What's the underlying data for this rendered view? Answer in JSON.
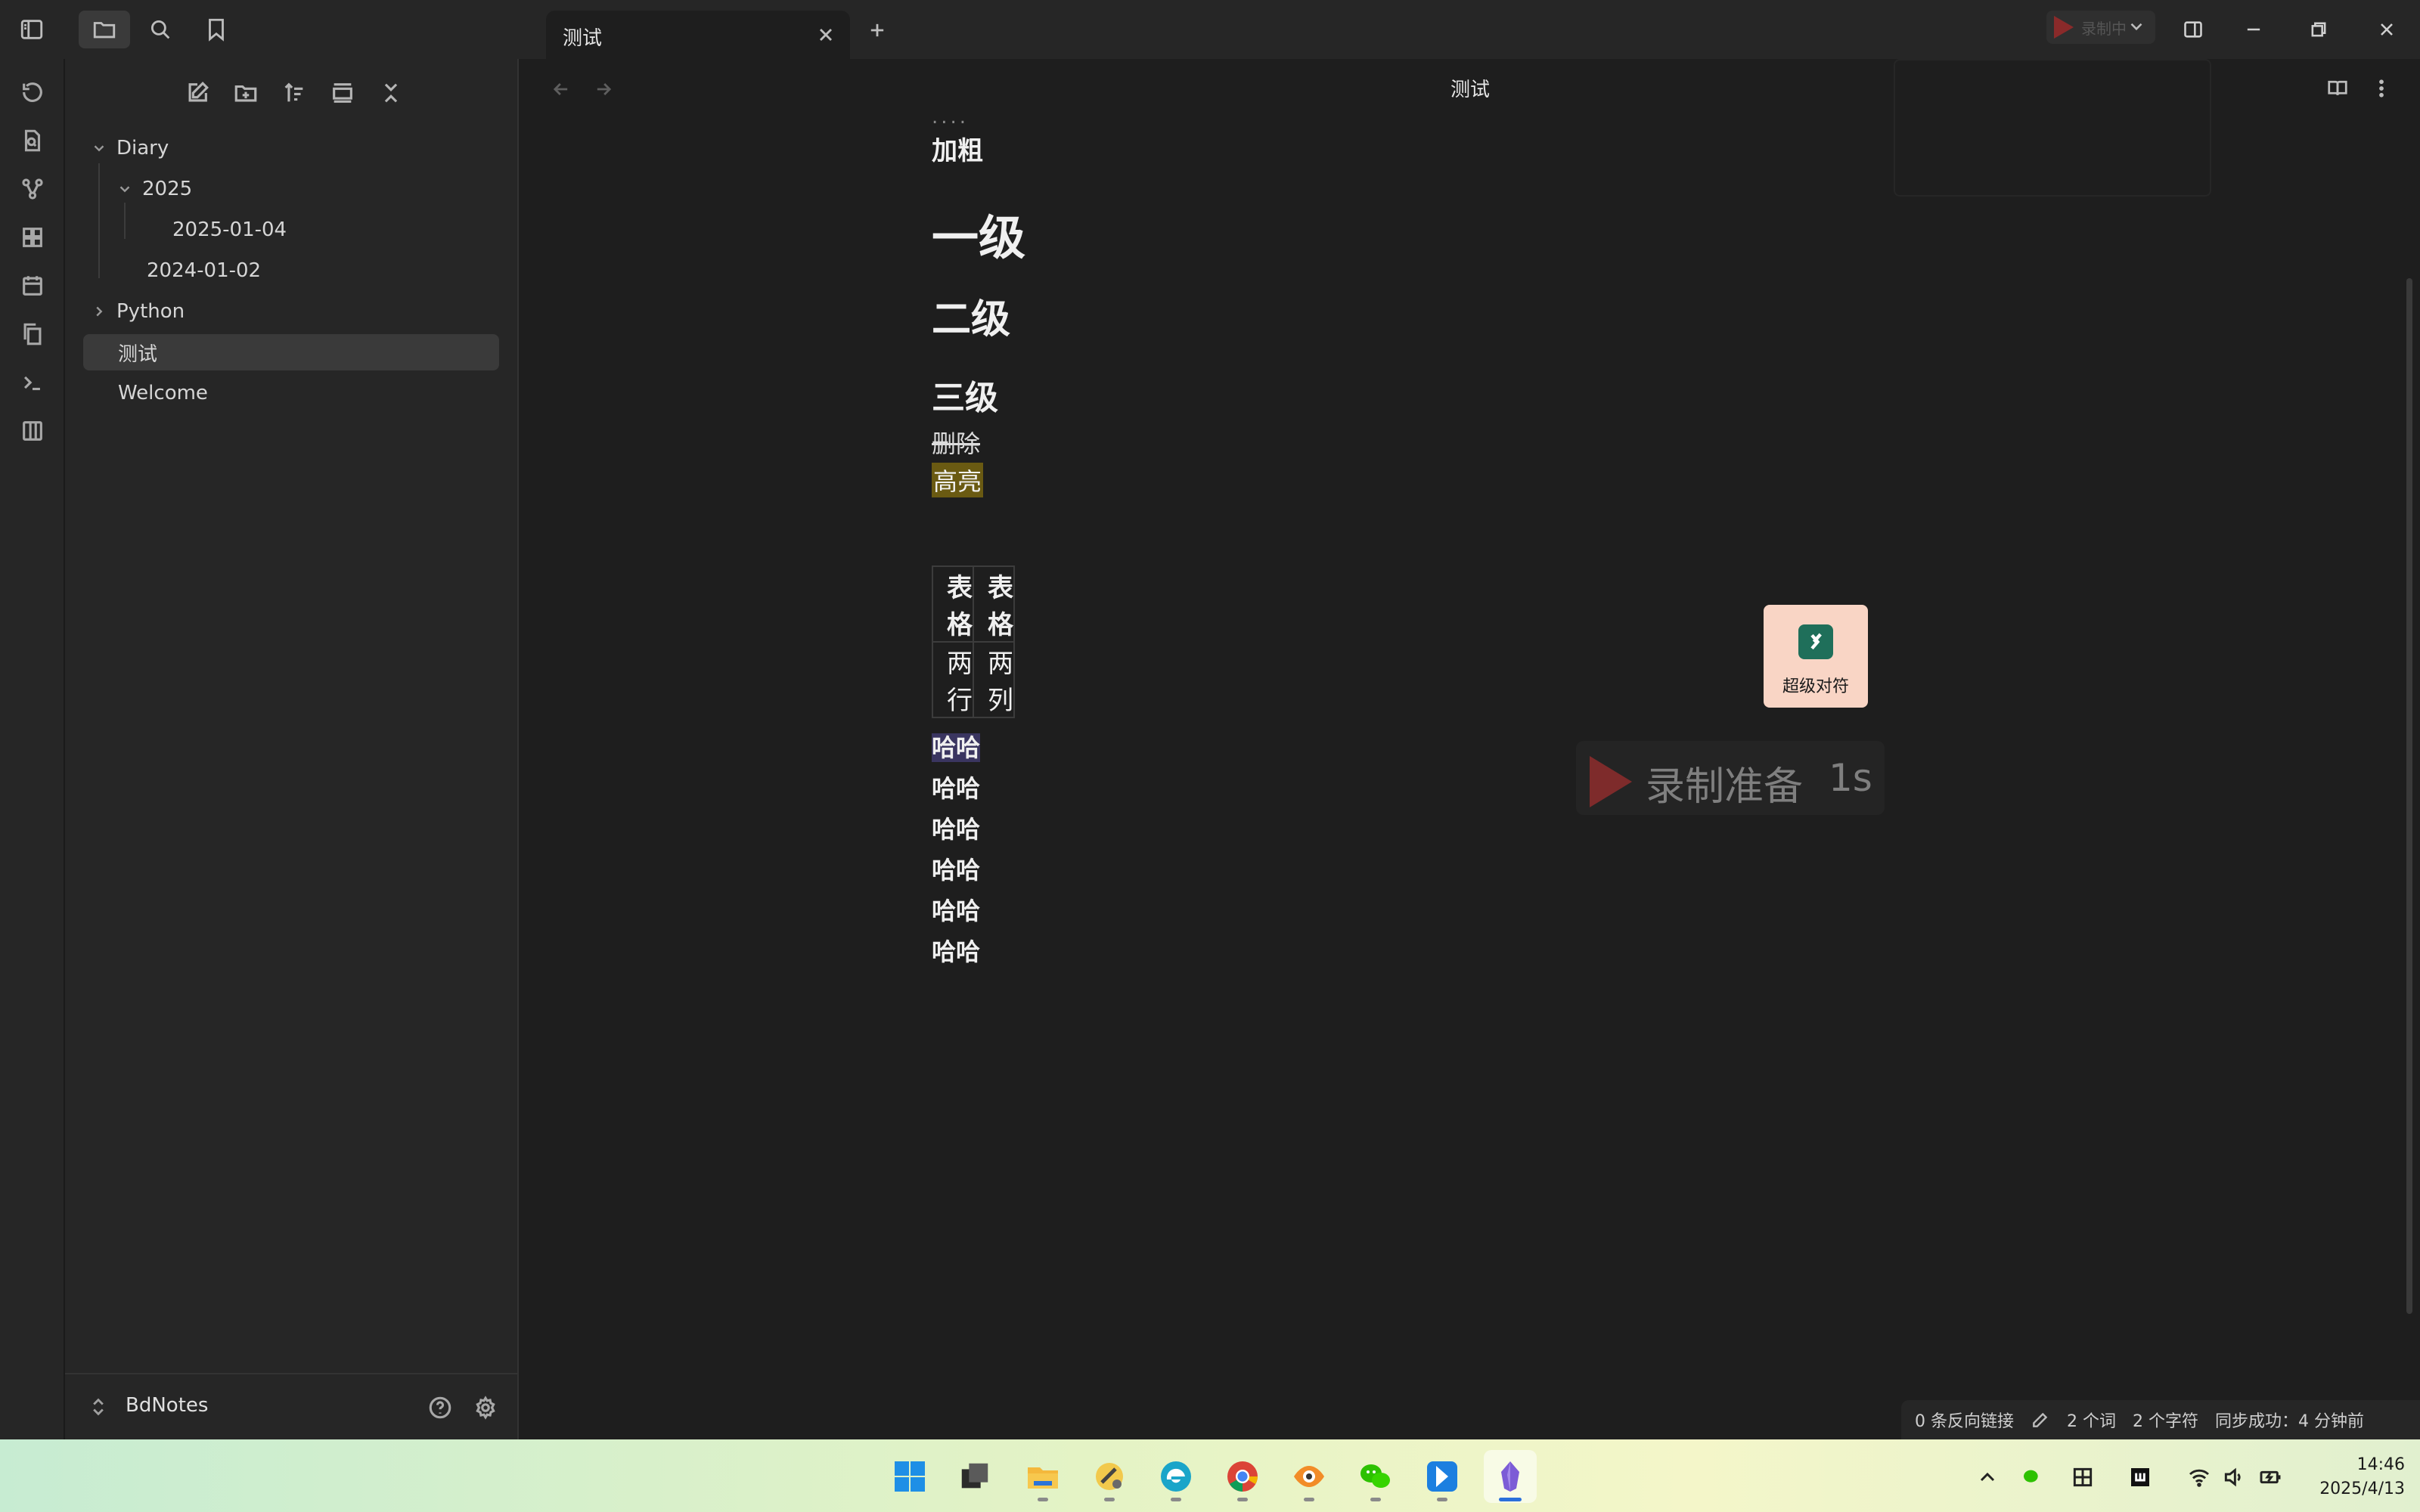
{
  "tab": {
    "title": "测试"
  },
  "recorder": {
    "label": "录制中",
    "overlay_text": "录制准备",
    "overlay_seconds": "1s"
  },
  "sidebar": {
    "tree": [
      {
        "label": "Diary",
        "level": 0,
        "expanded": true
      },
      {
        "label": "2025",
        "level": 1,
        "expanded": true
      },
      {
        "label": "2025-01-04",
        "level": 2
      },
      {
        "label": "2024-01-02",
        "level": 1
      },
      {
        "label": "Python",
        "level": 0,
        "expanded": false
      },
      {
        "label": "测试",
        "level": 0,
        "selected": true
      },
      {
        "label": "Welcome",
        "level": 0
      }
    ],
    "vault_name": "BdNotes"
  },
  "editor": {
    "view_title": "测试",
    "dots": "....",
    "lines": {
      "bold": "加粗",
      "h1": "一级",
      "h2": "二级",
      "h3": "三级",
      "strike": "删除",
      "highlight": "高亮"
    },
    "table": {
      "headers": [
        "表格",
        "表格"
      ],
      "rows": [
        [
          "两行",
          "两列"
        ]
      ]
    },
    "repeated": [
      "哈哈",
      "哈哈",
      "哈哈",
      "哈哈",
      "哈哈",
      "哈哈"
    ]
  },
  "floating_tool": {
    "label": "超级对符"
  },
  "status": {
    "backlinks": "0 条反向链接",
    "words": "2 个词",
    "chars": "2 个字符",
    "sync": "同步成功：4 分钟前"
  },
  "taskbar": {
    "time": "14:46",
    "date": "2025/4/13"
  },
  "colors": {
    "highlight": "#6a5a12",
    "selection": "#3a3560",
    "float_card": "#f9d5c5"
  }
}
